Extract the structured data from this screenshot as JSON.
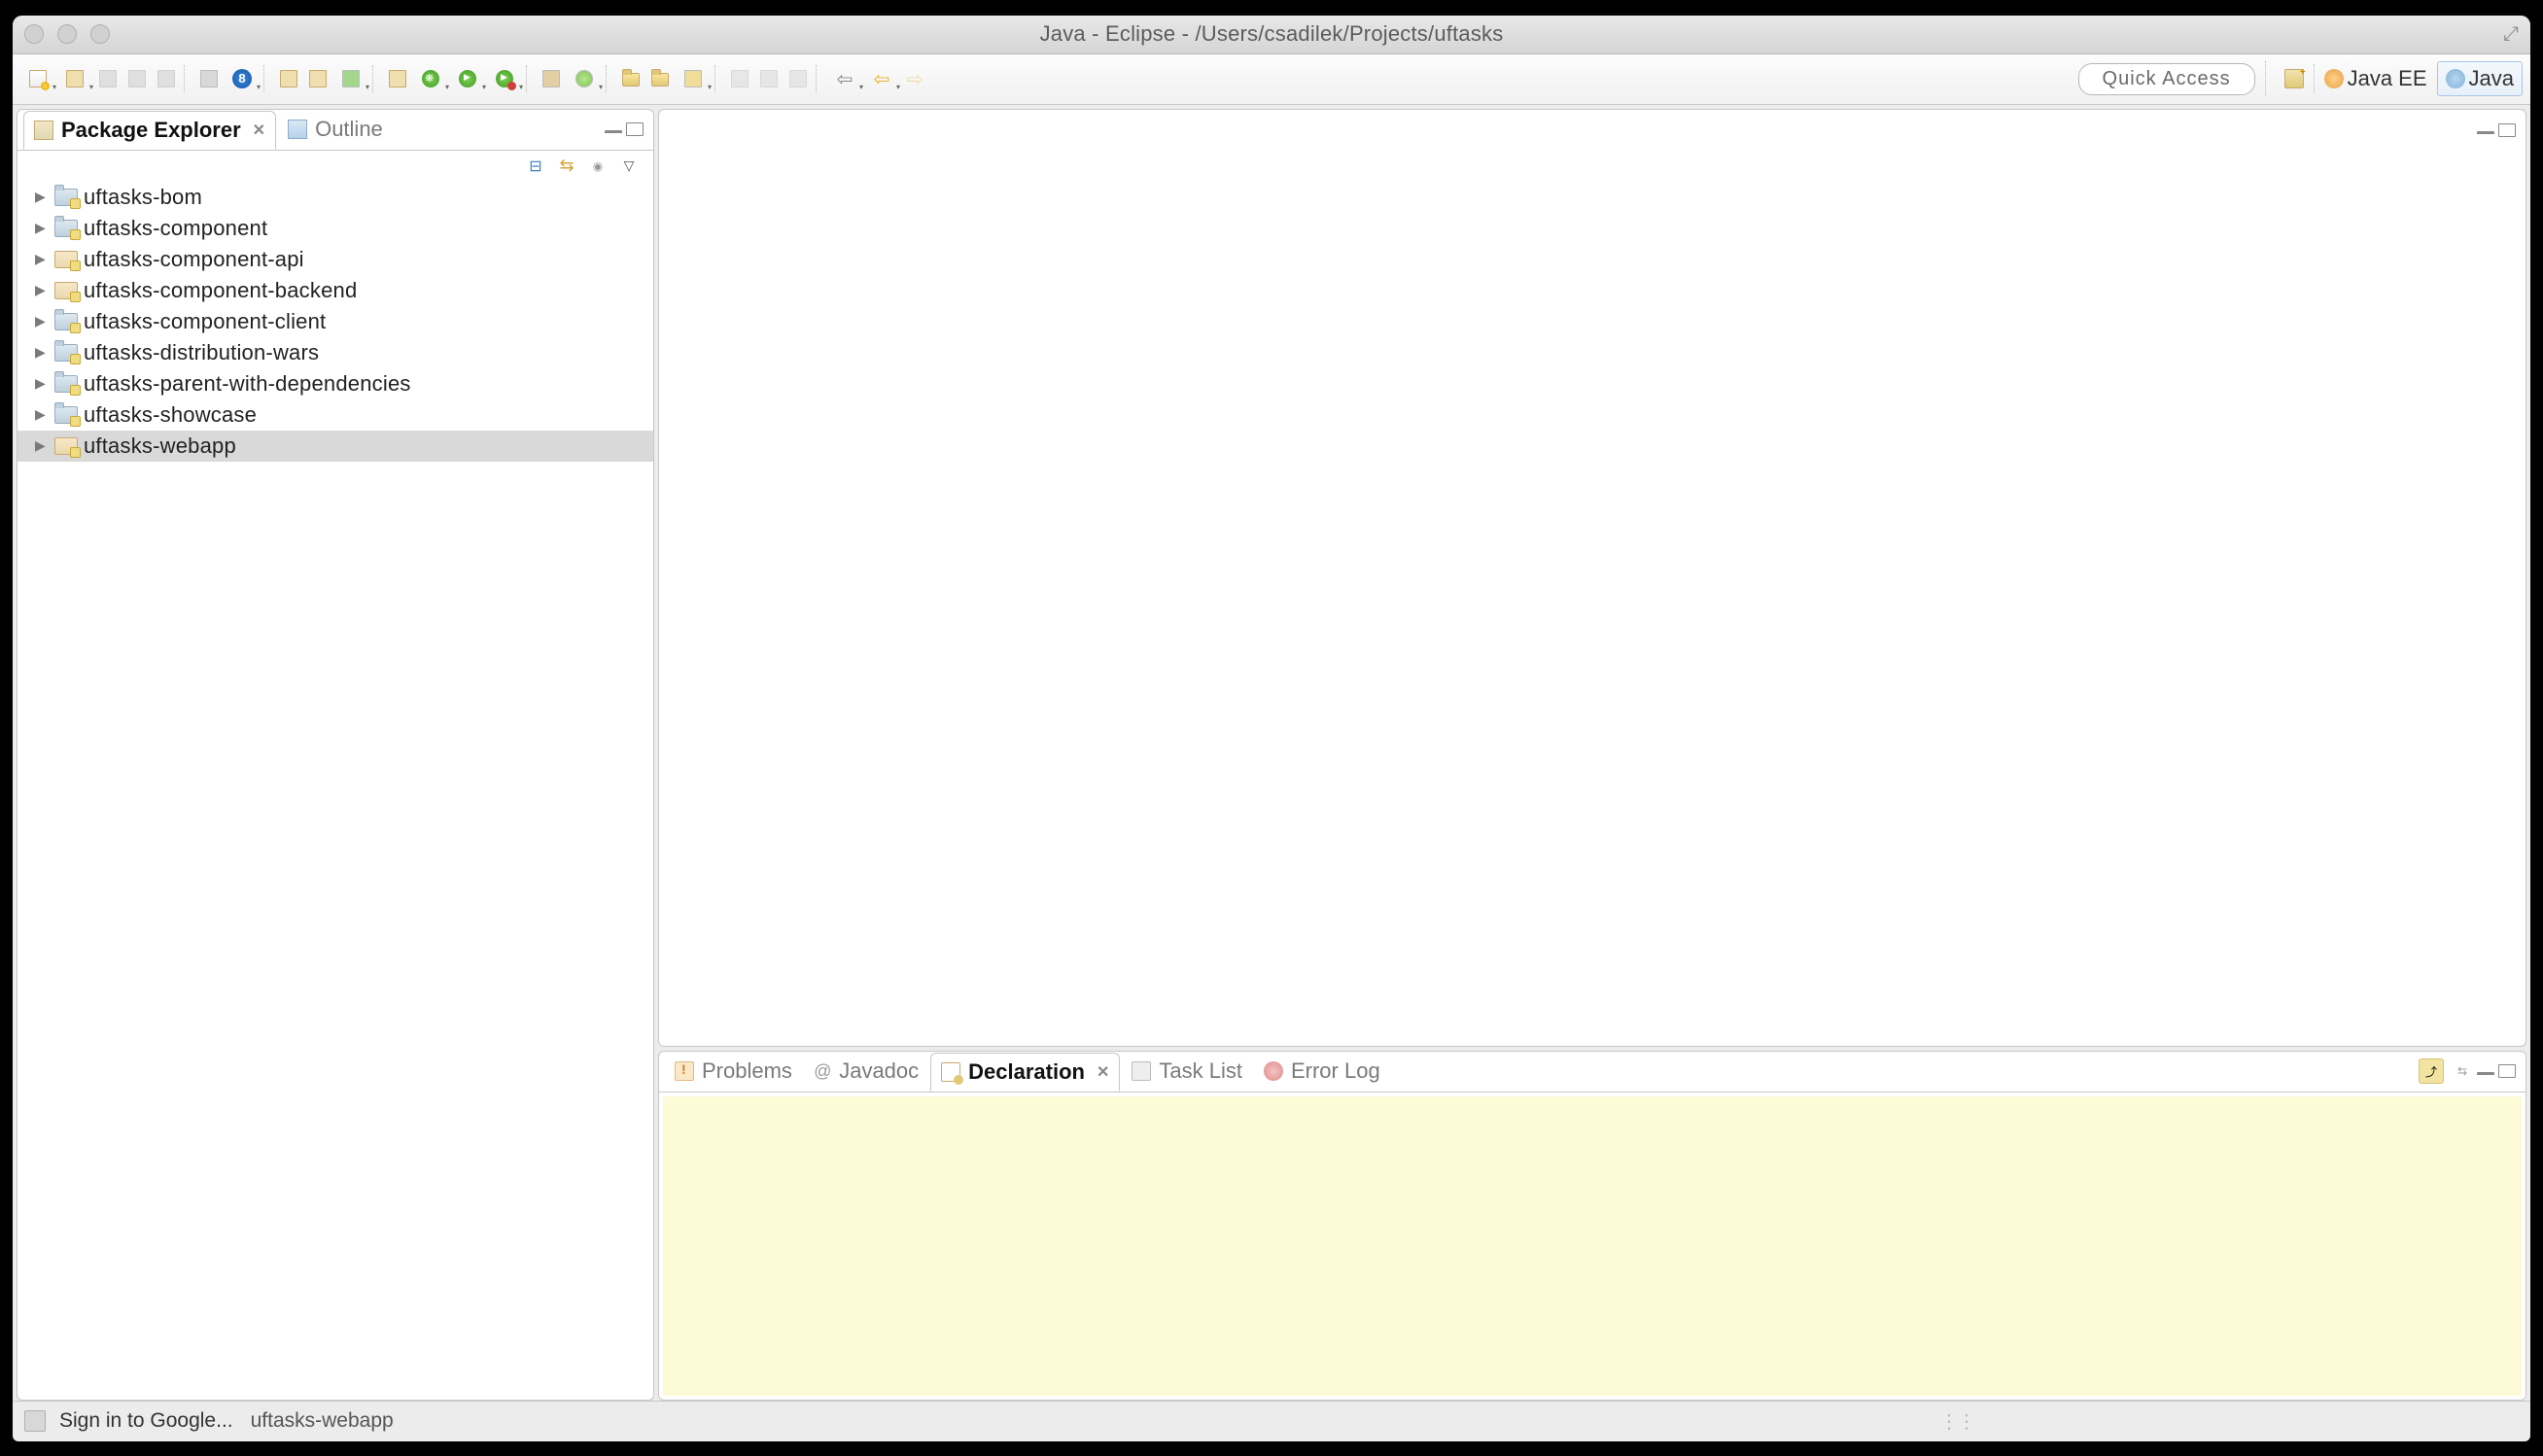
{
  "window": {
    "title": "Java - Eclipse - /Users/csadilek/Projects/uftasks"
  },
  "toolbar": {
    "quick_access": "Quick Access"
  },
  "perspectives": {
    "java_ee": "Java EE",
    "java": "Java"
  },
  "left_panel": {
    "tabs": {
      "package_explorer": "Package Explorer",
      "outline": "Outline"
    },
    "tree": {
      "items": [
        {
          "label": "uftasks-bom",
          "icon": "folder"
        },
        {
          "label": "uftasks-component",
          "icon": "folder"
        },
        {
          "label": "uftasks-component-api",
          "icon": "mvn"
        },
        {
          "label": "uftasks-component-backend",
          "icon": "mvn"
        },
        {
          "label": "uftasks-component-client",
          "icon": "folder"
        },
        {
          "label": "uftasks-distribution-wars",
          "icon": "folder"
        },
        {
          "label": "uftasks-parent-with-dependencies",
          "icon": "folder"
        },
        {
          "label": "uftasks-showcase",
          "icon": "folder"
        },
        {
          "label": "uftasks-webapp",
          "icon": "mvn",
          "selected": true
        }
      ]
    }
  },
  "bottom_panel": {
    "tabs": {
      "problems": "Problems",
      "javadoc": "Javadoc",
      "declaration": "Declaration",
      "task_list": "Task List",
      "error_log": "Error Log"
    }
  },
  "statusbar": {
    "sign_in": "Sign in to Google...",
    "selection": "uftasks-webapp"
  }
}
